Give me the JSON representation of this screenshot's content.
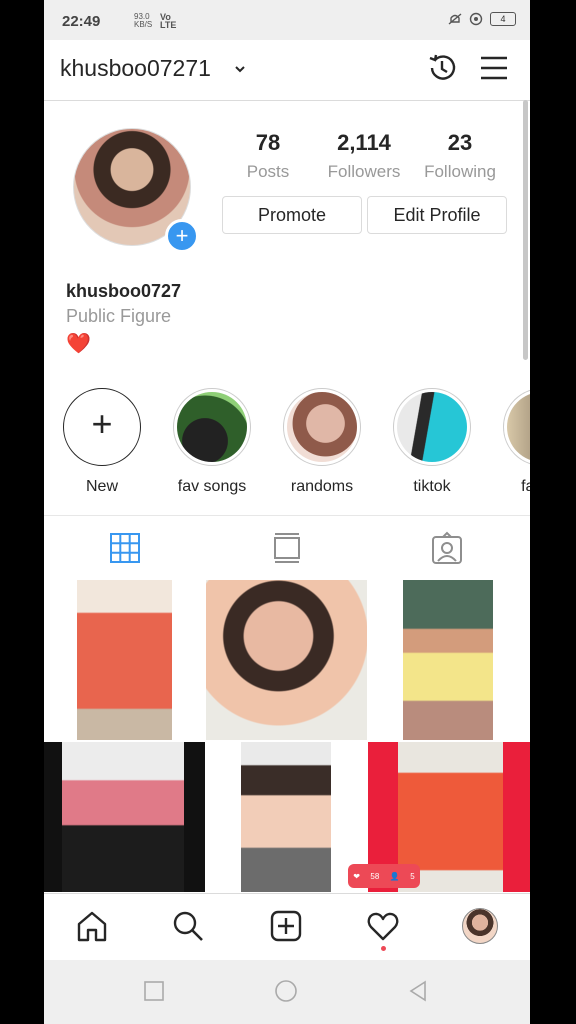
{
  "status": {
    "time": "22:49",
    "net_speed": "93.0",
    "net_unit": "KB/S",
    "network": "Vo LTE",
    "battery": "4"
  },
  "header": {
    "username": "khusboo07271"
  },
  "profile": {
    "stats": [
      {
        "value": "78",
        "label": "Posts"
      },
      {
        "value": "2,114",
        "label": "Followers"
      },
      {
        "value": "23",
        "label": "Following"
      }
    ],
    "promote_label": "Promote",
    "edit_label": "Edit Profile",
    "name": "khusboo0727",
    "category": "Public Figure",
    "bio_emoji": "❤️"
  },
  "highlights": [
    {
      "label": "New"
    },
    {
      "label": "fav songs"
    },
    {
      "label": "randoms"
    },
    {
      "label": "tiktok"
    },
    {
      "label": "fav tik"
    }
  ],
  "activity_badge": {
    "likes": "58",
    "follows": "5"
  },
  "colors": {
    "accent": "#3897f0",
    "notification": "#ed4956"
  }
}
